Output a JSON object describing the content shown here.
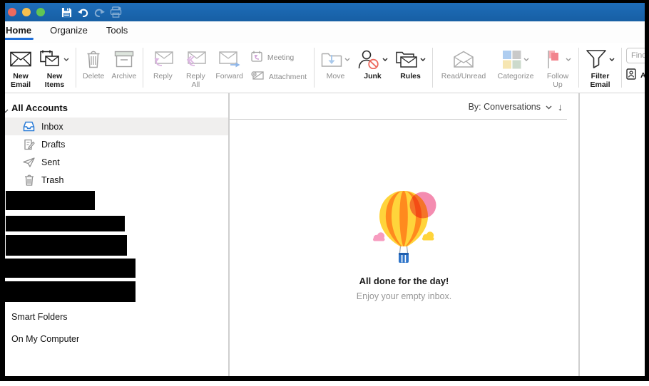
{
  "colors": {
    "titlebar_blue": "#1b67b2",
    "accent_blue": "#1f6fd8",
    "traffic_red": "#ec6a5e",
    "traffic_yellow": "#f5bf4f",
    "traffic_green": "#61c554",
    "disabled_text": "#8d8d8d",
    "enabled_text": "#1a1a1a",
    "balloon_yellow": "#ffd43b",
    "balloon_orange": "#ff8a1e",
    "balloon_pink": "#f2729f",
    "basket_blue": "#2e74c9"
  },
  "titlebar": {
    "traffic_lights": [
      "close",
      "minimize",
      "zoom"
    ],
    "quick_actions": [
      {
        "icon": "save-icon",
        "enabled": true
      },
      {
        "icon": "undo-icon",
        "enabled": true
      },
      {
        "icon": "redo-icon",
        "enabled": false
      },
      {
        "icon": "print-icon",
        "enabled": false
      }
    ]
  },
  "tabs": [
    {
      "label": "Home",
      "active": true
    },
    {
      "label": "Organize",
      "active": false
    },
    {
      "label": "Tools",
      "active": false
    }
  ],
  "ribbon": {
    "new_email": {
      "label": "New Email",
      "enabled": true,
      "dropdown": false,
      "icon": "envelope-icon"
    },
    "new_items": {
      "label": "New Items",
      "enabled": true,
      "dropdown": true,
      "icon": "calendar-envelope-icon"
    },
    "delete": {
      "label": "Delete",
      "enabled": false,
      "dropdown": false,
      "icon": "trash-icon"
    },
    "archive": {
      "label": "Archive",
      "enabled": false,
      "dropdown": false,
      "icon": "archive-box-icon"
    },
    "reply": {
      "label": "Reply",
      "enabled": false,
      "dropdown": false,
      "icon": "reply-arrow-envelope-icon"
    },
    "reply_all": {
      "label": "Reply All",
      "enabled": false,
      "dropdown": false,
      "icon": "reply-all-arrow-envelope-icon"
    },
    "forward": {
      "label": "Forward",
      "enabled": false,
      "dropdown": false,
      "icon": "forward-arrow-envelope-icon"
    },
    "meeting": {
      "label": "Meeting",
      "enabled": false,
      "dropdown": false,
      "icon": "calendar-reply-icon"
    },
    "attachment": {
      "label": "Attachment",
      "enabled": false,
      "dropdown": false,
      "icon": "paperclip-envelope-icon"
    },
    "move": {
      "label": "Move",
      "enabled": false,
      "dropdown": true,
      "icon": "folder-down-arrow-icon"
    },
    "junk": {
      "label": "Junk",
      "enabled": true,
      "dropdown": true,
      "icon": "blocked-person-icon"
    },
    "rules": {
      "label": "Rules",
      "enabled": true,
      "dropdown": true,
      "icon": "folder-envelope-icon"
    },
    "read_unread": {
      "label": "Read/Unread",
      "enabled": false,
      "dropdown": false,
      "icon": "open-envelope-icon"
    },
    "categorize": {
      "label": "Categorize",
      "enabled": false,
      "dropdown": true,
      "icon": "color-squares-icon"
    },
    "follow_up": {
      "label": "Follow Up",
      "enabled": false,
      "dropdown": true,
      "icon": "flag-icon"
    },
    "filter_email": {
      "label": "Filter Email",
      "enabled": true,
      "dropdown": true,
      "icon": "funnel-icon"
    },
    "find_contact": {
      "placeholder": "Find a"
    },
    "address_book": {
      "label": "Add",
      "icon": "contact-card-icon"
    }
  },
  "sidebar": {
    "header": "All Accounts",
    "folders": [
      {
        "label": "Inbox",
        "icon": "inbox-tray-icon",
        "selected": true
      },
      {
        "label": "Drafts",
        "icon": "draft-pencil-icon",
        "selected": false
      },
      {
        "label": "Sent",
        "icon": "paper-plane-icon",
        "selected": false
      },
      {
        "label": "Trash",
        "icon": "trash-icon",
        "selected": false
      }
    ],
    "redacted_account_rows": 5,
    "sections": [
      {
        "label": "Smart Folders"
      },
      {
        "label": "On My Computer"
      }
    ]
  },
  "list": {
    "sort_label": "By: Conversations",
    "sort_dropdown_icon": "chevron-down-icon",
    "newest_on_top_icon": "down-arrow-icon",
    "down_arrow_glyph": "↓",
    "empty_state": {
      "illustration": "hot-air-balloon-illustration",
      "title": "All done for the day!",
      "subtitle": "Enjoy your empty inbox."
    }
  }
}
